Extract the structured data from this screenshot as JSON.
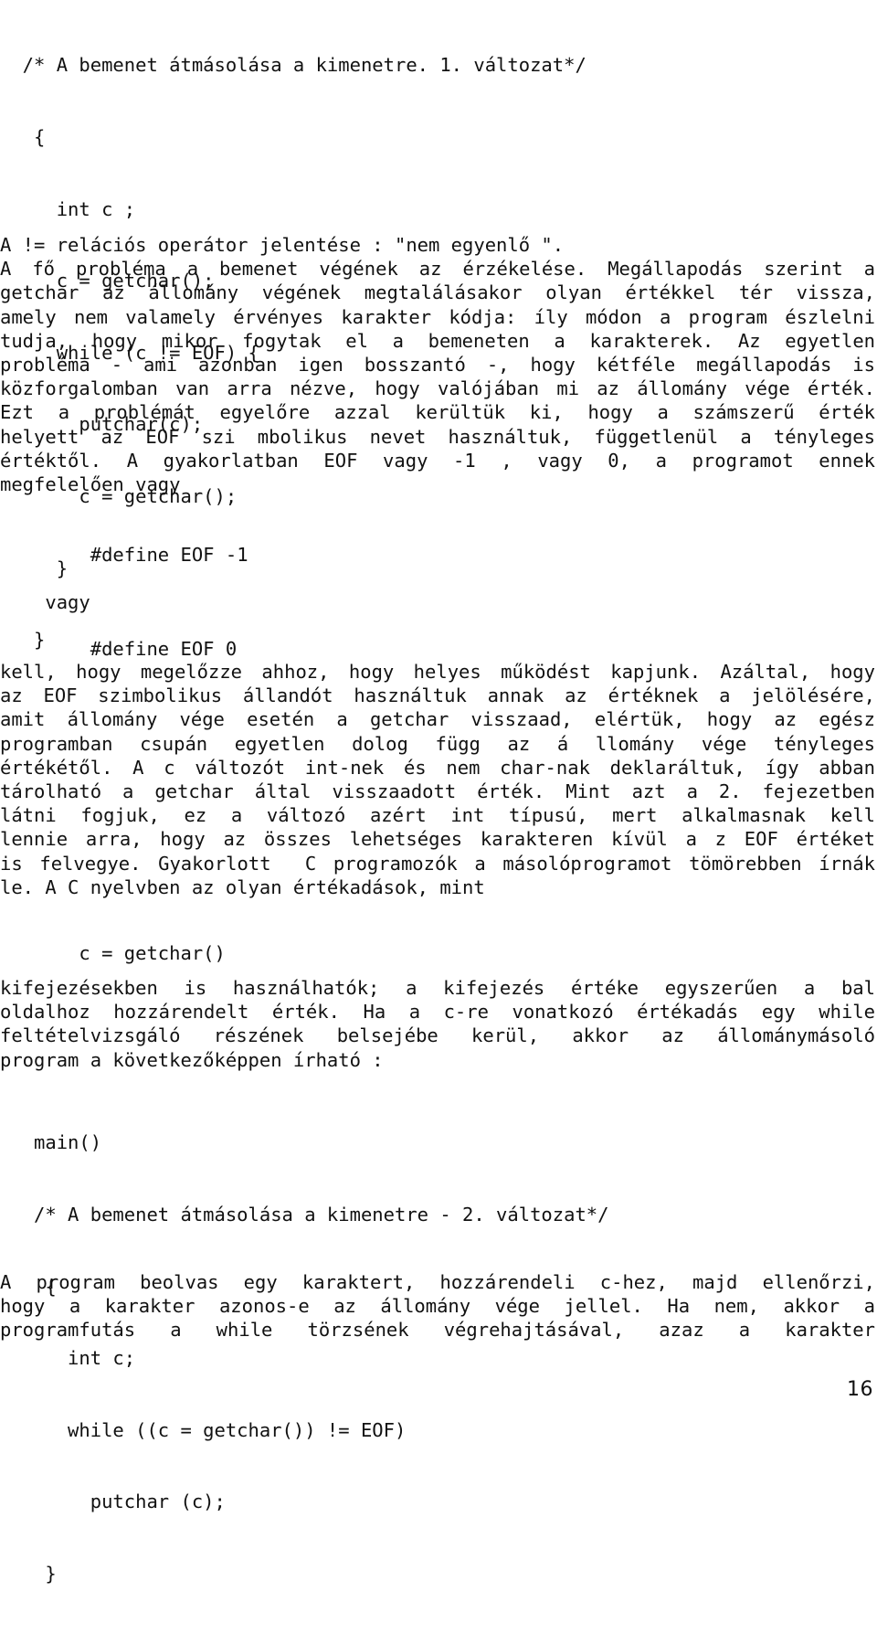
{
  "document": {
    "language": "hu",
    "page_number": "16",
    "font_style": "monospace-typewriter"
  },
  "code_block_1": {
    "name": "copy-input-to-output-v1",
    "lines": [
      "  /* A bemenet átmásolása a kimenetre. 1. változat*/",
      "   {",
      "     int c ;",
      "     c = getchar();",
      "     while (c != EOF) {",
      "       putchar(c);",
      "       c = getchar();",
      "     }",
      "   }"
    ]
  },
  "paragraph_1": {
    "lines": [
      "A != relációs operátor jelentése : \"nem egyenlő \".",
      "A fő probléma a bemenet végének az érzékelése. Megállapodás szerint a",
      "getchar az állomány végének megtalálásakor olyan értékkel tér vissza,",
      "amely nem valamely érvényes karakter kódja: íly módon a program észlelni",
      "tudja, hogy mikor fogytak el a bemeneten a karakterek. Az egyetlen",
      "probléma - ami azonban igen bosszantó -, hogy kétféle megállapodás is",
      "közforgalomban van arra nézve, hogy valójában mi az állomány vége érték.",
      "Ezt a problémát egyelőre azzal kerültük ki, hogy a számszerű érték",
      "helyett az EOF szi mbolikus nevet használtuk, függetlenül a tényleges",
      "értéktől. A gyakorlatban EOF vagy -1 , vagy 0, a programot ennek",
      "megfelelően vagy"
    ],
    "last_line_index": 10,
    "ragged_line_indices": [
      0,
      10
    ]
  },
  "define_1": {
    "text": "    #define EOF -1"
  },
  "or_label": {
    "text": "vagy"
  },
  "define_2": {
    "text": "    #define EOF 0"
  },
  "paragraph_2": {
    "lines": [
      "kell, hogy megelőzze ahhoz, hogy helyes működést kapjunk. Azáltal, hogy",
      "az EOF szimbolikus állandót használtuk annak az értéknek a jelölésére,",
      "amit állomány vége esetén a getchar visszaad, elértük, hogy az egész",
      "programban csupán egyetlen dolog függ az á llomány vége tényleges",
      "értékétől. A c változót int-nek és nem char-nak deklaráltuk, így abban",
      "tárolható a getchar által visszaadott érték. Mint azt a 2. fejezetben",
      "látni fogjuk, ez a változó azért int típusú, mert alkalmasnak kell",
      "lennie arra, hogy az összes lehetséges karakteren kívül a z EOF értéket",
      "is felvegye. Gyakorlott  C programozók a másolóprogramot tömörebben írnák",
      "le. A C nyelvben az olyan értékadások, mint"
    ],
    "last_line_index": 9
  },
  "code_snippet": {
    "text": "   c = getchar()"
  },
  "paragraph_3": {
    "lines": [
      "kifejezésekben is használhatók; a kifejezés értéke egyszerűen a bal",
      "oldalhoz hozzárendelt érték. Ha a c-re vonatkozó értékadás egy while",
      "feltételvizsgáló részének belsejébe kerül, akkor az állománymásoló",
      "program a következőképpen írható :"
    ],
    "last_line_index": 3
  },
  "code_block_2": {
    "name": "copy-input-to-output-v2",
    "lines": [
      "   main()",
      "   /* A bemenet átmásolása a kimenetre - 2. változat*/",
      "    {",
      "      int c;",
      "      while ((c = getchar()) != EOF)",
      "        putchar (c);",
      "    }"
    ]
  },
  "paragraph_4": {
    "lines": [
      "A program beolvas egy karaktert, hozzárendeli c-hez, majd ellenőrzi,",
      "hogy a karakter azonos-e az állomány vége jellel. Ha nem, akkor a",
      "programfutás a while törzsének végrehajtásával, azaz a karakter"
    ],
    "last_line_index": 2
  }
}
